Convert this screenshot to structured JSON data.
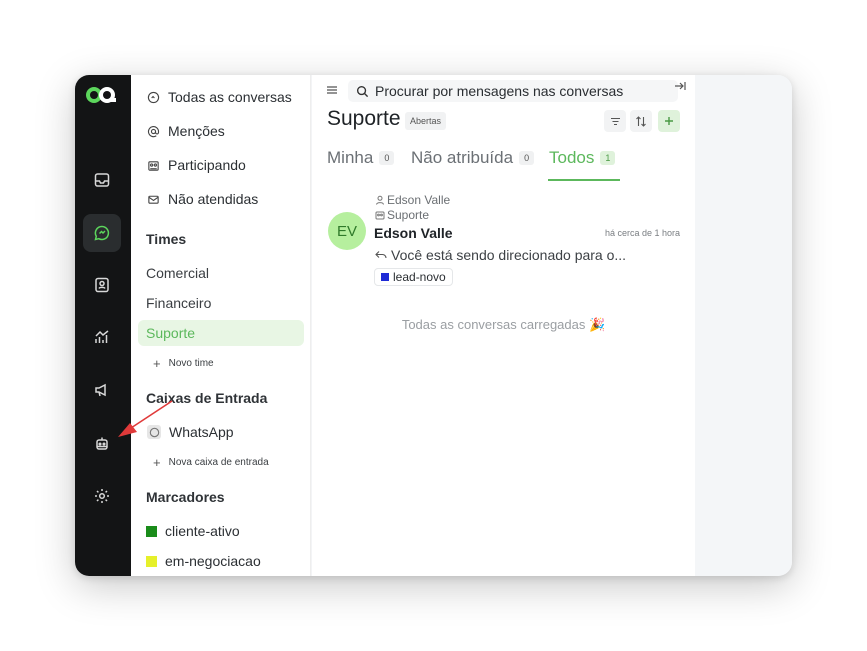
{
  "sidebar": {
    "nav": [
      {
        "label": "Todas as conversas",
        "icon": "chat-bubble-icon"
      },
      {
        "label": "Menções",
        "icon": "at-icon"
      },
      {
        "label": "Participando",
        "icon": "people-icon"
      },
      {
        "label": "Não atendidas",
        "icon": "envelope-icon"
      }
    ],
    "teams_heading": "Times",
    "teams": [
      "Comercial",
      "Financeiro",
      "Suporte"
    ],
    "new_team": "Novo time",
    "inboxes_heading": "Caixas de Entrada",
    "inboxes": [
      "WhatsApp"
    ],
    "new_inbox": "Nova caixa de entrada",
    "labels_heading": "Marcadores",
    "labels": [
      {
        "name": "cliente-ativo",
        "color": "#1a8c1a"
      },
      {
        "name": "em-negociacao",
        "color": "#e6f02a"
      }
    ]
  },
  "search": {
    "placeholder": "Procurar por mensagens nas conversas"
  },
  "header": {
    "title": "Suporte",
    "status": "Abertas"
  },
  "tabs": [
    {
      "label": "Minha",
      "count": "0"
    },
    {
      "label": "Não atribuída",
      "count": "0"
    },
    {
      "label": "Todos",
      "count": "1"
    }
  ],
  "conversation": {
    "agent": "Edson Valle",
    "team": "Suporte",
    "avatar_initials": "EV",
    "name": "Edson Valle",
    "time": "há cerca de 1 hora",
    "message": "Você está sendo direcionado para o...",
    "label": "lead-novo",
    "label_color": "#1f2bd6"
  },
  "loaded_text": "Todas as conversas carregadas 🎉",
  "colors": {
    "accent": "#5cb85c",
    "rail": "#131415",
    "arrow": "#e03a3a"
  }
}
